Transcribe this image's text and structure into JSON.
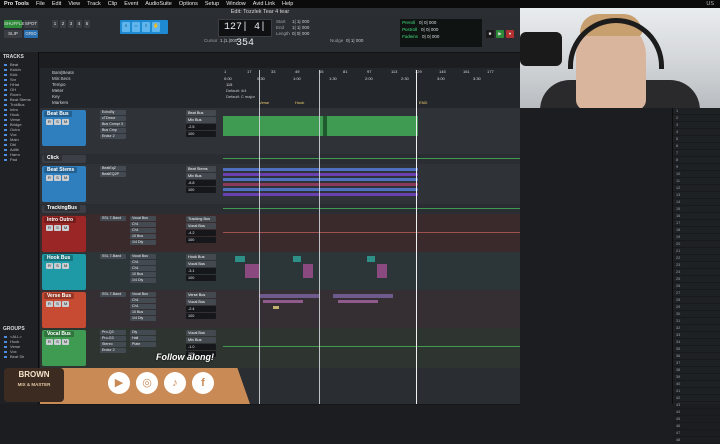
{
  "menubar": {
    "app": "Pro Tools",
    "items": [
      "File",
      "Edit",
      "View",
      "Track",
      "Clip",
      "Event",
      "AudioSuite",
      "Options",
      "Setup",
      "Window",
      "Avid Link",
      "Help"
    ],
    "right": "US"
  },
  "window_title": "Edit: Tozzlek Tear 4 tear",
  "toolbar": {
    "mode_buttons": [
      "SHUFFLE",
      "SPOT",
      "SLIP",
      "GRID"
    ],
    "counter": "127| 4| 354",
    "cursor_label": "Cursor",
    "cursor_value": "1.|1.|000",
    "nudge_label": "Nudge",
    "nudge_value": "0| 1| 000",
    "reads": [
      {
        "label": "Start",
        "value": "1| 1| 000"
      },
      {
        "label": "End",
        "value": "1| 1| 000"
      },
      {
        "label": "Length",
        "value": "0| 0| 000"
      }
    ],
    "transport": [
      {
        "label": "Preroll",
        "value": "0| 0| 000"
      },
      {
        "label": "Postroll",
        "value": "0| 0| 000"
      },
      {
        "label": "Fadeins",
        "value": "0| 0| 000"
      }
    ]
  },
  "left_panel": {
    "title": "TRACKS",
    "tracks": [
      "Beat",
      "KickIn",
      "Kick",
      "Snr",
      "HHat",
      "OH",
      "Room",
      "Beat Stems",
      "TrckBus",
      "Intro",
      "Hook",
      "Verse",
      "Bridge",
      "Outro",
      "Vox",
      "Main",
      "Dbl",
      "Adlib",
      "Harm",
      "Pad"
    ],
    "groups_title": "GROUPS",
    "groups": [
      "<ALL>",
      "Hook",
      "Verse",
      "Vox",
      "Beat Sh"
    ]
  },
  "ruler": {
    "rows": [
      "Bars|Beats",
      "Min:Secs",
      "Tempo",
      "Meter",
      "Key",
      "Markers"
    ],
    "ticks": [
      "1",
      "17",
      "33",
      "49",
      "65",
      "81",
      "97",
      "113",
      "129",
      "145",
      "161",
      "177"
    ],
    "time_ticks": [
      "0:00",
      "0:30",
      "1:00",
      "1:30",
      "2:00",
      "2:30",
      "3:00",
      "3:30"
    ],
    "tempo_value": "115",
    "meter_value": "Default: 4/4",
    "key_value": "Default: C major",
    "markers": [
      "Verse",
      "Hook",
      "END"
    ]
  },
  "tracks": [
    {
      "name": "Beat Bus",
      "color": "#2f7fbf",
      "inserts": [
        "EchoBy",
        "cTDexor",
        "Bus Compr 3",
        "Bus Cmp",
        "Endur 2"
      ],
      "sends": [
        "",
        "",
        "",
        "",
        ""
      ],
      "io_in": "Beat Bus",
      "io_out": "Mix Bus",
      "vol": "-2.5",
      "pan": "100",
      "lane_color": "#3f9b52"
    },
    {
      "name": "Click",
      "color": "#4b4f56",
      "inserts": [],
      "sends": [],
      "io_in": "",
      "io_out": "",
      "vol": "",
      "pan": "",
      "lane_color": "#3f9b52"
    },
    {
      "name": "Beat Stems",
      "color": "#2f7fbf",
      "inserts": [
        "BeatEq2",
        "BeatEQ2P"
      ],
      "sends": [],
      "io_in": "Beat Stems",
      "io_out": "Mix Bus",
      "vol": "-6.8",
      "pan": "100",
      "lane_color": "#3f5aa8"
    },
    {
      "name": "TrackingBus",
      "color": "#4b4f56",
      "inserts": [],
      "sends": [],
      "io_in": "",
      "io_out": "",
      "vol": "",
      "pan": "",
      "lane_color": "#3f9b52"
    },
    {
      "name": "Intro Outro",
      "color": "#9b2626",
      "inserts": [
        "SSL 7-Band"
      ],
      "sends": [
        "Vocal Bus",
        "Ch1",
        "Ch1",
        "10 Bus",
        "1/4 Dly"
      ],
      "io_in": "Tracking Bus",
      "io_out": "Vocal Bus",
      "vol": "-4.2",
      "pan": "100",
      "lane_color": "#8a3a3a"
    },
    {
      "name": "Hook Bus",
      "color": "#1e9aa6",
      "inserts": [
        "SSL 7-Band"
      ],
      "sends": [
        "Vocal Bus",
        "Ch1",
        "Ch1",
        "10 Bus",
        "1/4 Dly"
      ],
      "io_in": "Hook Bus",
      "io_out": "Vocal Bus",
      "vol": "-3.1",
      "pan": "100",
      "lane_color": "#2e8f86"
    },
    {
      "name": "Verse Bus",
      "color": "#c74a33",
      "inserts": [
        "SSL 7-Band"
      ],
      "sends": [
        "Vocal Bus",
        "Ch1",
        "Ch1",
        "10 Bus",
        "1/4 Dly"
      ],
      "io_in": "Verse Bus",
      "io_out": "Vocal Bus",
      "vol": "-2.4",
      "pan": "100",
      "lane_color": "#8e5b8c"
    },
    {
      "name": "Vocal Bus",
      "color": "#3f9b52",
      "inserts": [
        "Pro-Q3",
        "Pro-G3",
        "Stereo",
        "Endur 2"
      ],
      "sends": [
        "Dly",
        "Hall",
        "Plate",
        ""
      ],
      "io_in": "Vocal Bus",
      "io_out": "Mix Bus",
      "vol": "-1.0",
      "pan": "100",
      "lane_color": "#3f9b52"
    }
  ],
  "right_meters": {
    "rows": [
      "1",
      "2",
      "3",
      "4",
      "5",
      "6",
      "7",
      "8",
      "9",
      "10",
      "11",
      "12",
      "13",
      "14",
      "15",
      "16",
      "17",
      "18",
      "19",
      "20",
      "21",
      "22",
      "23",
      "24",
      "25",
      "26",
      "27",
      "28",
      "29",
      "30",
      "31",
      "32",
      "33",
      "34",
      "35",
      "36",
      "37",
      "38",
      "39",
      "40",
      "41",
      "42",
      "43",
      "44",
      "45",
      "46",
      "47",
      "48"
    ]
  },
  "overlay": {
    "follow_text": "Follow along!",
    "logo_main": "BROWN",
    "logo_sub": "MIX & MASTER",
    "socials": [
      "youtube-icon",
      "instagram-icon",
      "tiktok-icon",
      "facebook-icon"
    ]
  },
  "colors": {
    "accent": "#2d9ce8",
    "green_read": "#3ee07a",
    "banner": "#c98a56"
  }
}
